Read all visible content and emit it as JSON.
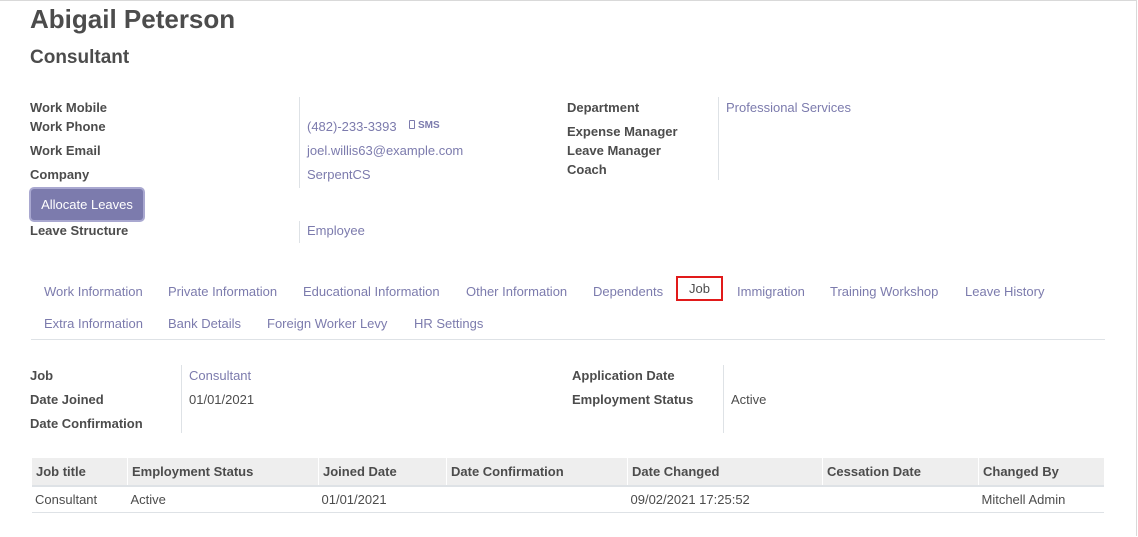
{
  "employee": {
    "name": "Abigail Peterson",
    "job_title": "Consultant"
  },
  "contact": {
    "work_mobile_label": "Work Mobile",
    "work_phone_label": "Work Phone",
    "work_phone": "(482)-233-3393",
    "sms_label": "SMS",
    "work_email_label": "Work Email",
    "work_email": "joel.willis63@example.com",
    "company_label": "Company",
    "company": "SerpentCS",
    "allocate_button": "Allocate Leaves",
    "leave_structure_label": "Leave Structure",
    "leave_structure": "Employee"
  },
  "org": {
    "department_label": "Department",
    "department": "Professional Services",
    "expense_manager_label": "Expense Manager",
    "leave_manager_label": "Leave Manager",
    "coach_label": "Coach"
  },
  "tabs": [
    {
      "label": "Work Information"
    },
    {
      "label": "Private Information"
    },
    {
      "label": "Educational Information"
    },
    {
      "label": "Other Information"
    },
    {
      "label": "Dependents"
    },
    {
      "label": "Job"
    },
    {
      "label": "Immigration"
    },
    {
      "label": "Training Workshop"
    },
    {
      "label": "Leave History"
    },
    {
      "label": "Extra Information"
    },
    {
      "label": "Bank Details"
    },
    {
      "label": "Foreign Worker Levy"
    },
    {
      "label": "HR Settings"
    }
  ],
  "active_tab": "Job",
  "job_tab": {
    "job_label": "Job",
    "job": "Consultant",
    "date_joined_label": "Date Joined",
    "date_joined": "01/01/2021",
    "date_confirmation_label": "Date Confirmation",
    "application_date_label": "Application Date",
    "employment_status_label": "Employment Status",
    "employment_status": "Active"
  },
  "history_table": {
    "headers": [
      "Job title",
      "Employment Status",
      "Joined Date",
      "Date Confirmation",
      "Date Changed",
      "Cessation Date",
      "Changed By"
    ],
    "rows": [
      [
        "Consultant",
        "Active",
        "01/01/2021",
        "",
        "09/02/2021 17:25:52",
        "",
        "Mitchell Admin"
      ]
    ]
  },
  "colors": {
    "accent": "#7c7bad",
    "active_tab_border": "#e11a1a",
    "text": "#4c4c4c"
  }
}
